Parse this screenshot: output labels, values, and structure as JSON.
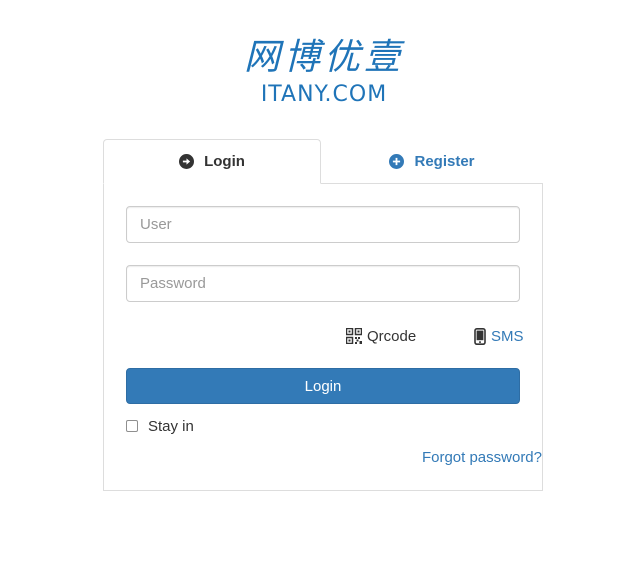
{
  "logo": {
    "chinese": "网博优壹",
    "english": "ITANY.COM"
  },
  "tabs": [
    {
      "label": "Login",
      "icon": "arrow-circle-right-icon",
      "active": true
    },
    {
      "label": "Register",
      "icon": "plus-circle-icon",
      "active": false
    }
  ],
  "form": {
    "user_placeholder": "User",
    "password_placeholder": "Password",
    "qrcode_label": "Qrcode",
    "sms_label": "SMS",
    "login_button": "Login",
    "stay_label": "Stay in",
    "forgot_label": "Forgot password?"
  },
  "colors": {
    "brand": "#1f74b8",
    "primary": "#337ab7",
    "border": "#dddddd",
    "text": "#333333"
  }
}
